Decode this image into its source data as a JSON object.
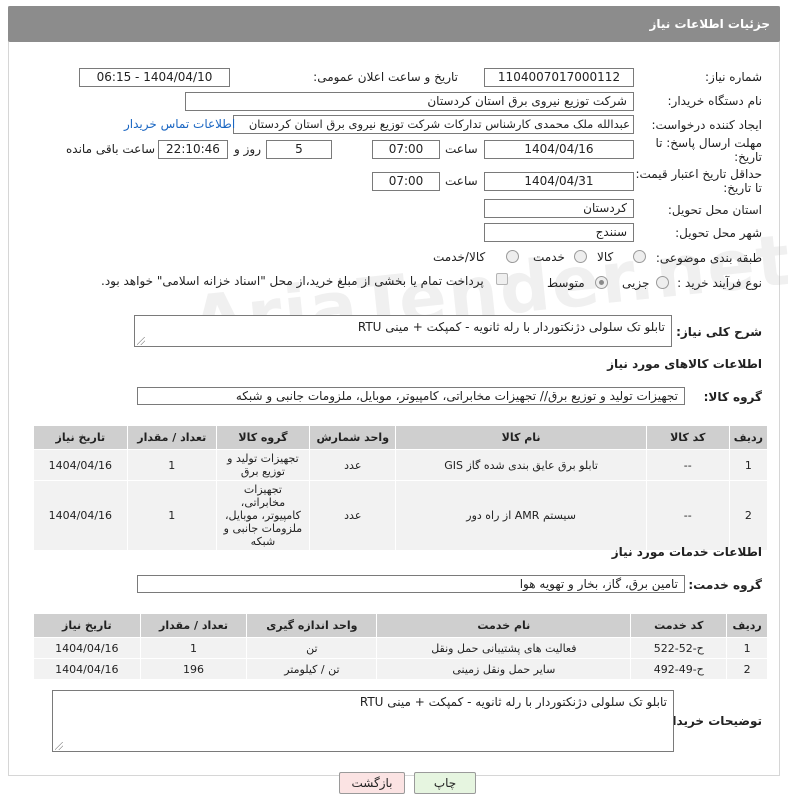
{
  "header": {
    "title": "جزئیات اطلاعات نیاز"
  },
  "fields": {
    "need_number_label": "شماره نیاز:",
    "need_number": "1104007017000112",
    "announce_label": "تاریخ و ساعت اعلان عمومی:",
    "announce_value": "1404/04/10 - 06:15",
    "buyer_label": "نام دستگاه خریدار:",
    "buyer_value": "شرکت توزیع نیروی برق استان کردستان",
    "creator_label": "ایجاد کننده درخواست:",
    "creator_value": "عبدالله ملک محمدی کارشناس تدارکات شرکت توزیع نیروی برق استان کردستان",
    "contact_link": "اطلاعات تماس خریدار",
    "deadline_label": "مهلت ارسال پاسخ: تا تاریخ:",
    "deadline_date": "1404/04/16",
    "time_label": "ساعت",
    "deadline_time": "07:00",
    "days_value": "5",
    "days_label": "روز و",
    "remaining_time": "22:10:46",
    "remaining_label": "ساعت باقی مانده",
    "validity_label": "حداقل تاریخ اعتبار قیمت: تا تاریخ:",
    "validity_date": "1404/04/31",
    "validity_time": "07:00",
    "province_label": "استان محل تحویل:",
    "province_value": "کردستان",
    "city_label": "شهر محل تحویل:",
    "city_value": "سنندج",
    "category_label": "طبقه بندی موضوعی:",
    "category_options": [
      "کالا",
      "خدمت",
      "کالا/خدمت"
    ],
    "process_label": "نوع فرآیند خرید :",
    "process_options": [
      "جزیی",
      "متوسط"
    ],
    "payment_note": "پرداخت تمام یا بخشی از مبلغ خرید،از محل \"اسناد خزانه اسلامی\" خواهد بود."
  },
  "description": {
    "label": "شرح کلی نیاز:",
    "value": "تابلو تک سلولی دژنکتوردار با رله ثانویه - کمپکت + مینی RTU"
  },
  "goods": {
    "section_title": "اطلاعات کالاهای مورد نیاز",
    "group_label": "گروه کالا:",
    "group_value": "تجهیزات تولید و توزیع برق// تجهیزات مخابراتی، کامپیوتر، موبایل، ملزومات جانبی و شبکه",
    "headers": [
      "ردیف",
      "کد کالا",
      "نام کالا",
      "واحد شمارش",
      "گروه کالا",
      "تعداد / مقدار",
      "تاریخ نیاز"
    ],
    "rows": [
      [
        "1",
        "--",
        "تابلو برق عایق بندی شده گاز GIS",
        "عدد",
        "تجهیزات تولید و توزیع برق",
        "1",
        "1404/04/16"
      ],
      [
        "2",
        "--",
        "سیستم AMR از راه دور",
        "عدد",
        "تجهیزات مخابراتی، کامپیوتر، موبایل، ملزومات جانبی و شبکه",
        "1",
        "1404/04/16"
      ]
    ]
  },
  "services": {
    "section_title": "اطلاعات خدمات مورد نیاز",
    "group_label": "گروه خدمت:",
    "group_value": "تامین برق، گاز، بخار و تهویه هوا",
    "headers": [
      "ردیف",
      "کد خدمت",
      "نام خدمت",
      "واحد اندازه گیری",
      "تعداد / مقدار",
      "تاریخ نیاز"
    ],
    "rows": [
      [
        "1",
        "ح-52-522",
        "فعالیت های پشتیبانی حمل ونقل",
        "تن",
        "1",
        "1404/04/16"
      ],
      [
        "2",
        "ح-49-492",
        "سایر حمل ونقل زمینی",
        "تن / کیلومتر",
        "196",
        "1404/04/16"
      ]
    ]
  },
  "buyer_notes": {
    "label": "توضیحات خریدار:",
    "value": "تابلو تک سلولی دژنکتوردار با رله ثانویه - کمپکت + مینی RTU"
  },
  "buttons": {
    "print": "چاپ",
    "back": "بازگشت"
  },
  "watermark": "AriaTender.net",
  "colors": {
    "header_bg": "#8c8c8c",
    "link": "#1a66c2",
    "back_bg": "#fbe3e3",
    "print_bg": "#e6f5e0"
  }
}
